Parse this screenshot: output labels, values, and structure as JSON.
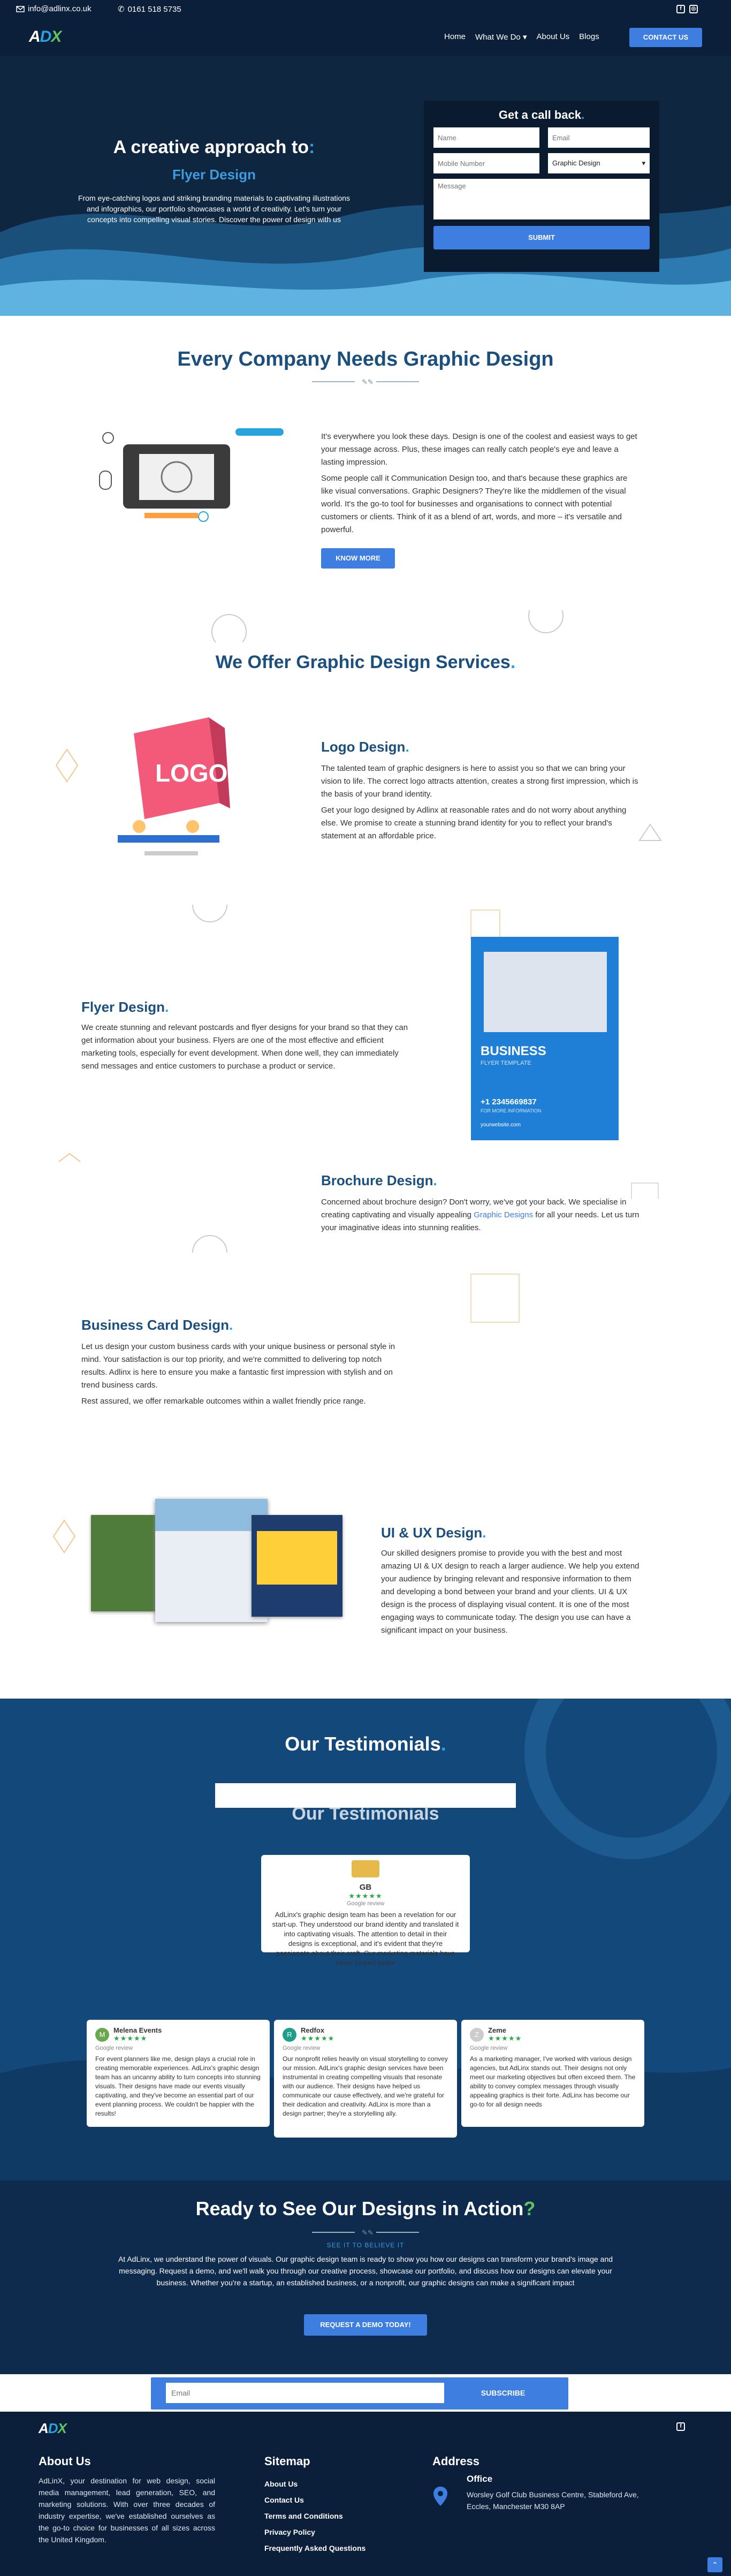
{
  "topbar": {
    "email": "info@adlinx.co.uk",
    "phone": "0161 518 5735"
  },
  "nav": {
    "logo_a": "A",
    "logo_d": "D",
    "logo_x": "X",
    "links": [
      "Home",
      "What We Do",
      "About Us",
      "Blogs"
    ],
    "caret": "▾",
    "cta": "CONTACT US"
  },
  "hero": {
    "title_prefix": "A creative approach to",
    "colon": ":",
    "subtitle": "Flyer Design",
    "desc": "From eye-catching logos and striking branding materials to captivating illustrations and infographics, our portfolio showcases a world of creativity. Let's turn your concepts into compelling visual stories. Discover the power of design with us",
    "form": {
      "title": "Get a call back",
      "dot": ".",
      "name_ph": "Name",
      "email_ph": "Email",
      "mobile_ph": "Mobile Number",
      "service_value": "Graphic Design",
      "message_ph": "Message",
      "submit": "SUBMIT"
    }
  },
  "intro": {
    "title": "Every Company Needs Graphic Design",
    "p1": "It's everywhere you look these days. Design is one of the coolest and easiest ways to get your message across. Plus, these images can really catch people's eye and leave a lasting impression.",
    "p2": "Some people call it Communication Design too, and that's because these graphics are like visual conversations. Graphic Designers? They're like the middlemen of the visual world. It's the go-to tool for businesses and organisations to connect with potential customers or clients. Think of it as a blend of art, words, and more – it's versatile and powerful.",
    "btn": "KNOW MORE"
  },
  "services": {
    "title": "We Offer Graphic Design Services",
    "dot": ".",
    "logo": {
      "title": "Logo Design",
      "art": "LOGO",
      "p1": "The talented team of graphic designers is here to assist you so that we can bring your vision to life. The correct logo attracts attention, creates a strong first impression, which is the basis of your brand identity.",
      "p2": "Get your logo designed by Adlinx at reasonable rates and do not worry about anything else. We promise to create a stunning brand identity for you to reflect your brand's statement at an affordable price."
    },
    "flyer": {
      "title": "Flyer Design",
      "p1": "We create stunning and relevant postcards and flyer designs for your brand so that they can get information about your business. Flyers are one of the most effective and efficient marketing tools, especially for event development. When done well, they can immediately send messages and entice customers to purchase a product or service.",
      "flyer_title": "BUSINESS",
      "flyer_sub": "FLYER TEMPLATE",
      "flyer_phone": "+1 2345669837",
      "flyer_more": "FOR MORE INFORMATION",
      "flyer_url": "yourwebsite.com"
    },
    "brochure": {
      "title": "Brochure Design",
      "p1a": "Concerned about brochure design? Don't worry, we've got your back. We specialise in creating captivating and visually appealing ",
      "link": "Graphic Designs",
      "p1b": " for all your needs. Let us turn your imaginative ideas into stunning realities."
    },
    "card": {
      "title": "Business Card Design",
      "p1": "Let us design your custom business cards with your unique business or personal style in mind. Your satisfaction is our top priority, and we're committed to delivering top notch results. Adlinx is here to ensure you make a fantastic first impression with stylish and on trend business cards.",
      "p2": "Rest assured, we offer remarkable outcomes within a wallet friendly price range."
    },
    "uiux": {
      "title": "UI & UX Design",
      "p1": "Our skilled designers promise to provide you with the best and most amazing UI & UX design to reach a larger audience. We help you extend your audience by bringing relevant and responsive information to them and developing a bond between your brand and your clients. UI & UX design is the process of displaying visual content. It is one of the most engaging ways to communicate today. The design you use can have a significant impact on your business."
    }
  },
  "testimonials": {
    "title": "Our Testimonials",
    "dot": ".",
    "ghost": "Our Testimonials",
    "featured": {
      "name": "GB",
      "stars": "★★★★★",
      "src": "Google review",
      "text": "AdLinx's graphic design team has been a revelation for our start-up. They understood our brand identity and translated it into captivating visuals. The attention to detail in their designs is exceptional, and it's evident that they're passionate about their craft. Our marketing materials have never looked better"
    },
    "items": [
      {
        "initial": "M",
        "name": "Melena Events",
        "stars": "★★★★★",
        "src": "Google review",
        "text": "For event planners like me, design plays a crucial role in creating memorable experiences. AdLinx's graphic design team has an uncanny ability to turn concepts into stunning visuals. Their designs have made our events visually captivating, and they've become an essential part of our event planning process. We couldn't be happier with the results!"
      },
      {
        "initial": "R",
        "name": "Redfox",
        "stars": "★★★★★",
        "src": "Google review",
        "text": "Our nonprofit relies heavily on visual storytelling to convey our mission. AdLinx's graphic design services have been instrumental in creating compelling visuals that resonate with our audience. Their designs have helped us communicate our cause effectively, and we're grateful for their dedication and creativity. AdLinx is more than a design partner; they're a storytelling ally."
      },
      {
        "initial": "Z",
        "name": "Zeme",
        "stars": "★★★★★",
        "src": "Google review",
        "text": "As a marketing manager, I've worked with various design agencies, but AdLinx stands out. Their designs not only meet our marketing objectives but often exceed them. The ability to convey complex messages through visually appealing graphics is their forte. AdLinx has become our go-to for all design needs"
      }
    ]
  },
  "cta": {
    "title": "Ready to See Our Designs in Action",
    "q": "?",
    "eyebrow": "SEE IT TO BELIEVE IT",
    "text": "At AdLinx, we understand the power of visuals. Our graphic design team is ready to show you how our designs can transform your brand's image and messaging. Request a demo, and we'll walk you through our creative process, showcase our portfolio, and discuss how our designs can elevate your business. Whether you're a startup, an established business, or a nonprofit, our graphic designs can make a significant impact",
    "btn": "REQUEST A DEMO TODAY!"
  },
  "newsletter": {
    "placeholder": "Email",
    "btn": "SUBSCRIBE"
  },
  "footer": {
    "about_title": "About Us",
    "about_text": "AdLinX, your destination for web design, social media management, lead generation, SEO, and marketing solutions. With over three decades of industry expertise, we've established ourselves as the go-to choice for businesses of all sizes across the United Kingdom.",
    "sitemap_title": "Sitemap",
    "sitemap": [
      "About Us",
      "Contact Us",
      "Terms and Conditions",
      "Privacy Policy",
      "Frequently Asked Questions"
    ],
    "address_title": "Address",
    "office_label": "Office",
    "office": "Worsley Golf Club Business Centre, Stableford Ave, Eccles, Manchester M30 8AP"
  },
  "colors": {
    "navy": "#0b1f3a",
    "accent": "#3d7ee0",
    "cyan": "#29a3e0",
    "heading": "#1b4f7e",
    "green": "#5fc35f"
  }
}
